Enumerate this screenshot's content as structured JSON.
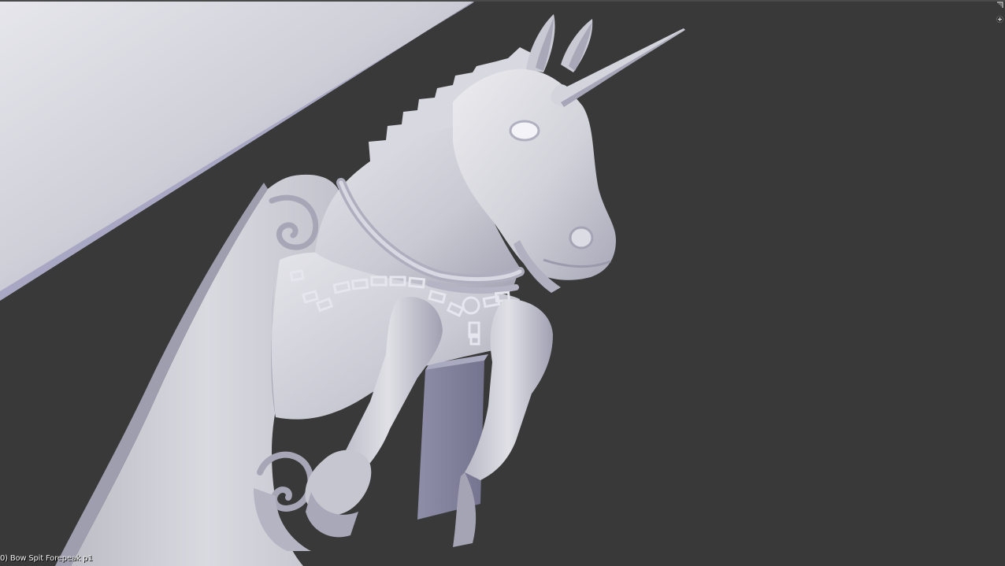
{
  "viewport": {
    "object_label": "0) Bow Spit Forepeak p1",
    "background_color": "#393939",
    "model_color": "#c8c8d8"
  },
  "widgets": {
    "top_right_icon": "corner-drag-icon",
    "split_icon": "plus-icon"
  }
}
